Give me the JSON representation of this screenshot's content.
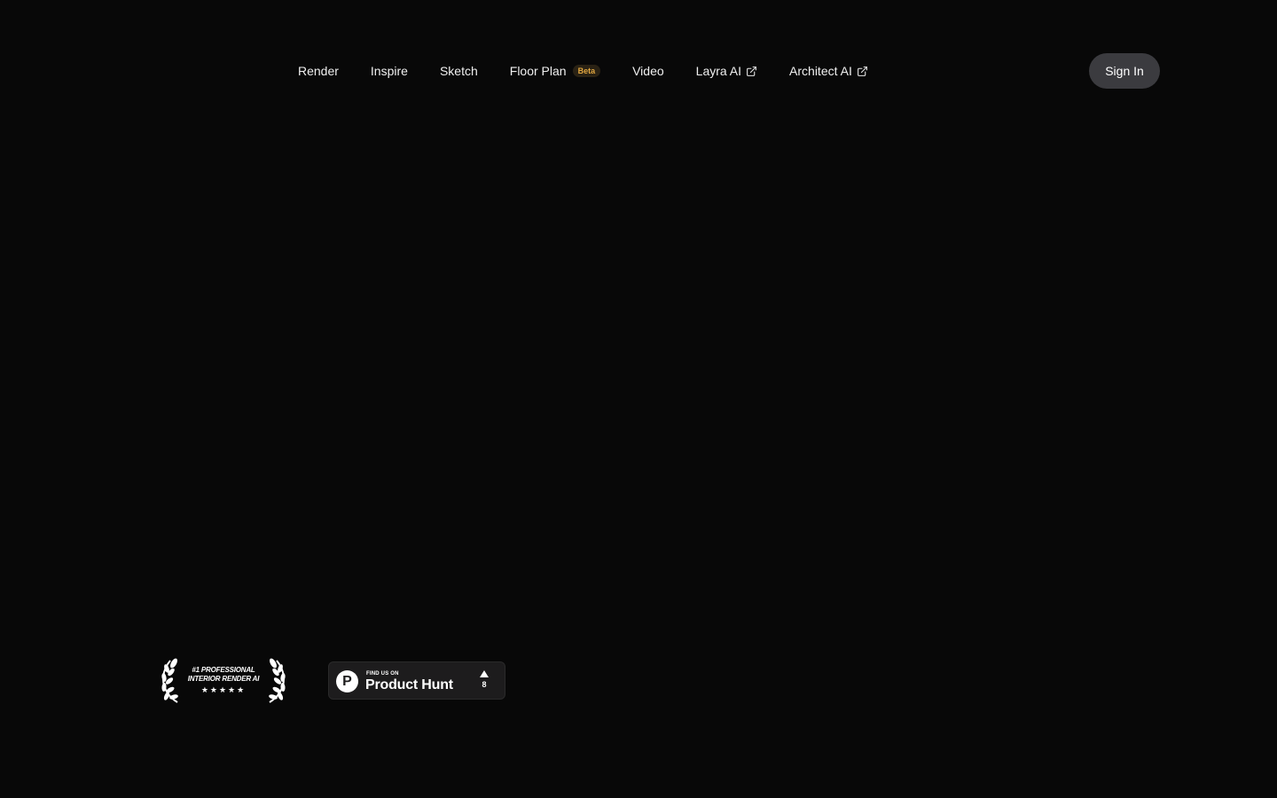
{
  "nav": {
    "links": [
      {
        "label": "Render"
      },
      {
        "label": "Inspire"
      },
      {
        "label": "Sketch"
      },
      {
        "label": "Floor Plan",
        "badge": "Beta"
      },
      {
        "label": "Video"
      },
      {
        "label": "Layra AI",
        "icon": "external-link-icon"
      },
      {
        "label": "Architect AI",
        "icon": "external-link-icon"
      }
    ],
    "signin_label": "Sign In"
  },
  "award": {
    "line1": "#1 PROFESSIONAL",
    "line2": "INTERIOR RENDER AI",
    "stars": "★★★★★",
    "icon": "laurel-wreath-icon"
  },
  "product_hunt": {
    "small_text": "FIND US ON",
    "big_text": "Product Hunt",
    "logo_letter": "P",
    "upvote_count": "8",
    "icon": "product-hunt-logo-icon"
  },
  "colors": {
    "background": "#080808",
    "signin_bg": "#3b3b3f",
    "beta_text": "#e0a640",
    "badge_bg": "#1d1c1d"
  }
}
